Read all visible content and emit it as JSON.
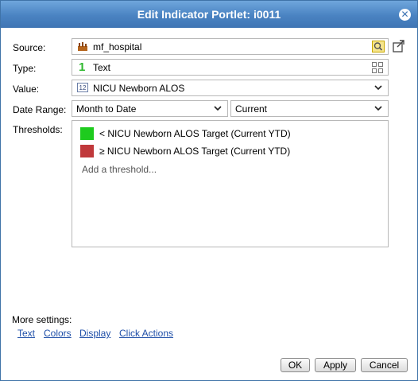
{
  "dialog": {
    "title": "Edit Indicator Portlet: i0011",
    "close_icon": "close-icon"
  },
  "form": {
    "source": {
      "label": "Source:",
      "value": "mf_hospital",
      "icon": "database-icon",
      "search_icon": "search-icon",
      "external_icon": "open-external-icon"
    },
    "type": {
      "label": "Type:",
      "value": "Text",
      "icon": "number-one-icon",
      "grid_icon": "grid-icon"
    },
    "value": {
      "label": "Value:",
      "value": "NICU Newborn ALOS",
      "icon": "metric-12-icon"
    },
    "date_range": {
      "label": "Date Range:",
      "period": "Month to Date",
      "offset": "Current"
    },
    "thresholds": {
      "label": "Thresholds:",
      "items": [
        {
          "label": "< NICU Newborn ALOS Target (Current YTD)",
          "color": "#1ecb1e"
        },
        {
          "label": "≥ NICU Newborn ALOS Target (Current YTD)",
          "color": "#c0393b"
        }
      ],
      "add_label": "Add a threshold..."
    }
  },
  "more_settings": {
    "label": "More settings:",
    "links": [
      "Text",
      "Colors",
      "Display",
      "Click Actions"
    ]
  },
  "buttons": {
    "ok": "OK",
    "apply": "Apply",
    "cancel": "Cancel"
  },
  "colors": {
    "titlebar": "#4a83c2",
    "link": "#1f4fa8"
  }
}
